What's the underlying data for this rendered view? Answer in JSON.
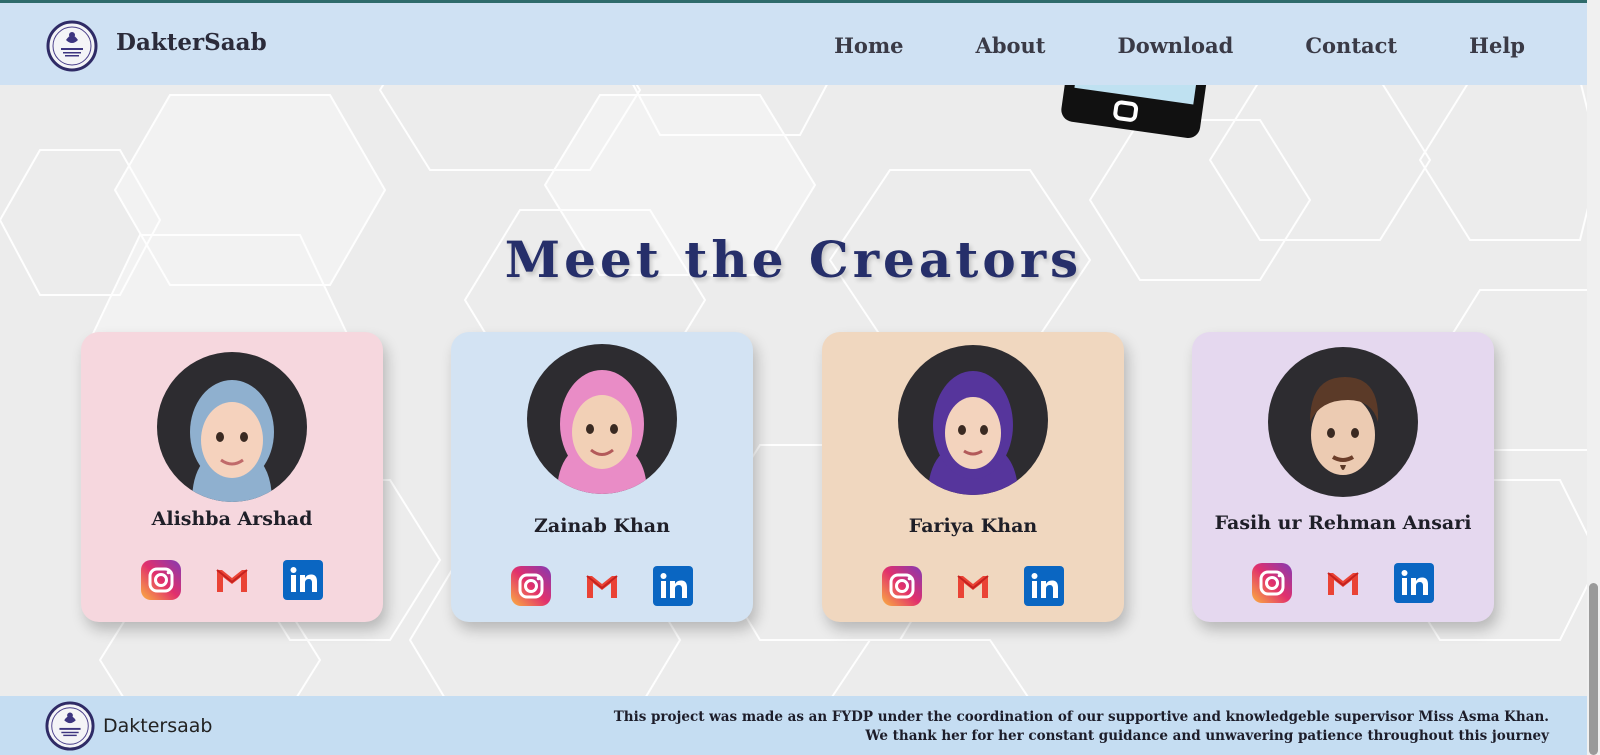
{
  "header": {
    "brand": "DakterSaab",
    "nav": [
      "Home",
      "About",
      "Download",
      "Contact",
      "Help"
    ]
  },
  "section": {
    "title": "Meet the Creators"
  },
  "creators": [
    {
      "name": "Alishba Arshad",
      "card_color": "#f6d7de",
      "headscarf_color": "#8fb0cf"
    },
    {
      "name": "Zainab Khan",
      "card_color": "#d3e3f3",
      "headscarf_color": "#e98cc6"
    },
    {
      "name": "Fariya Khan",
      "card_color": "#f0d7bf",
      "headscarf_color": "#56359c"
    },
    {
      "name": "Fasih ur Rehman Ansari",
      "card_color": "#e5d8ef",
      "headscarf_color": null
    }
  ],
  "footer": {
    "brand": "Daktersaab",
    "note_line1": "This project was made as an FYDP under the coordination of our supportive and knowledgeble supervisor Miss Asma Khan.",
    "note_line2": "We thank her for her constant guidance and unwavering patience throughout this journey"
  },
  "icons": [
    "instagram-icon",
    "gmail-icon",
    "linkedin-icon"
  ]
}
